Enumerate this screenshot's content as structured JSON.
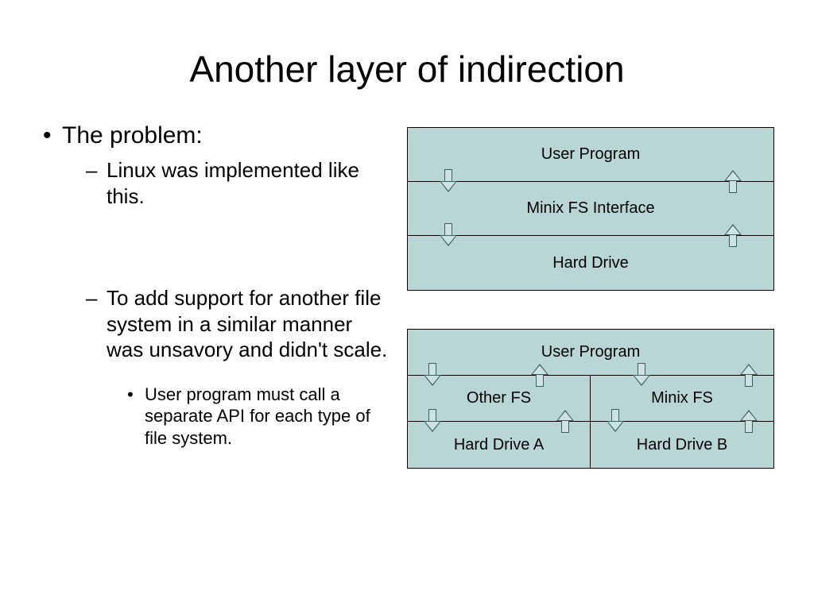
{
  "title": "Another layer of indirection",
  "bullets": {
    "b1": "The problem:",
    "b2a": "Linux was implemented like this.",
    "b2b": "To add support for another file system in a similar manner was unsavory and didn't scale.",
    "b3": "User program must call a separate API for each type of file system."
  },
  "diagram1": {
    "row1": "User Program",
    "row2": "Minix FS Interface",
    "row3": "Hard Drive"
  },
  "diagram2": {
    "row1": "User Program",
    "row2_left": "Other FS",
    "row2_right": "Minix FS",
    "row3_left": "Hard Drive A",
    "row3_right": "Hard Drive B"
  }
}
